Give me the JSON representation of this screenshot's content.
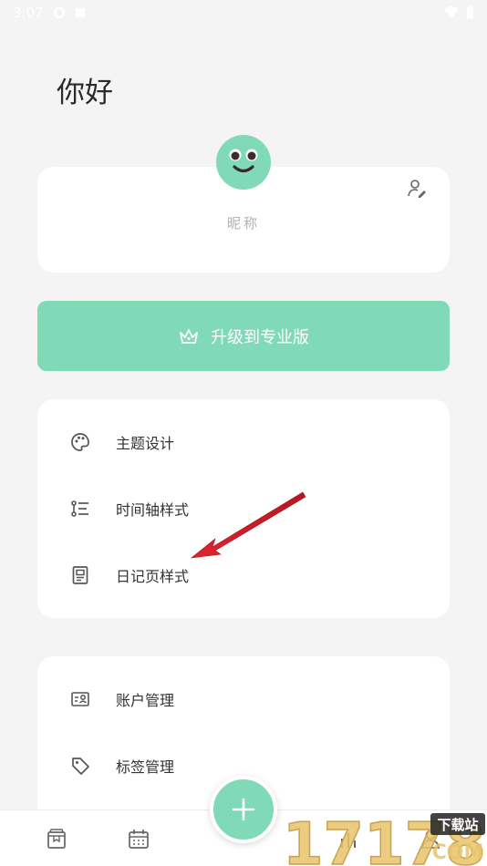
{
  "status_bar": {
    "time": "3:07"
  },
  "greeting": "你好",
  "profile": {
    "nickname": "昵称"
  },
  "upgrade": {
    "label": "升级到专业版"
  },
  "settings_card": {
    "items": [
      {
        "label": "主题设计",
        "icon": "palette-icon"
      },
      {
        "label": "时间轴样式",
        "icon": "timeline-icon"
      },
      {
        "label": "日记页样式",
        "icon": "diary-page-icon"
      }
    ]
  },
  "management_card": {
    "items": [
      {
        "label": "账户管理",
        "icon": "account-card-icon"
      },
      {
        "label": "标签管理",
        "icon": "tag-icon"
      }
    ]
  },
  "bottom_nav": {
    "items": [
      "diary-book-icon",
      "calendar-icon",
      "add-icon",
      "stats-icon",
      "profile-icon"
    ]
  },
  "watermark": {
    "text": "17178",
    "badge": "下载站",
    "domain": "COM"
  },
  "colors": {
    "accent": "#80dab8",
    "background": "#f4f4f4",
    "arrow": "#d9202a"
  }
}
